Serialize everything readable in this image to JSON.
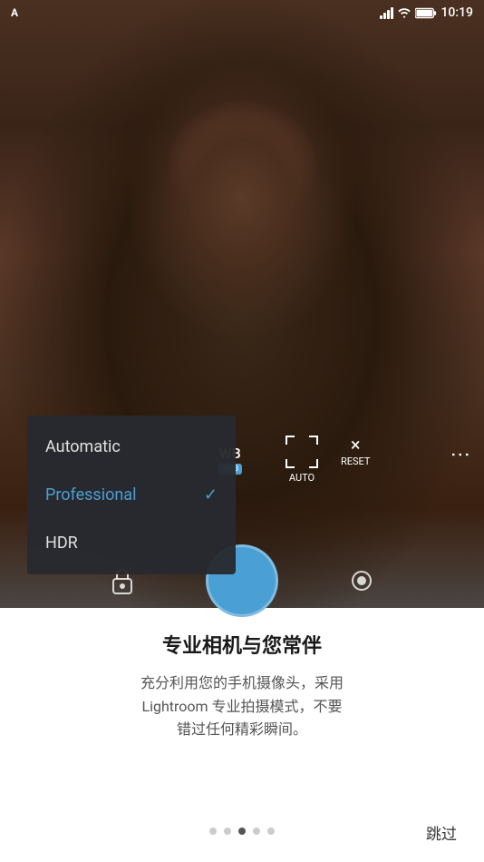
{
  "status_bar": {
    "time": "10:19"
  },
  "camera": {
    "wb_label": "WB",
    "wb_badge": "AWB",
    "auto_label": "AUTO",
    "reset_label": "RESET",
    "dots_label": "⋮"
  },
  "dropdown": {
    "items": [
      {
        "id": "automatic",
        "label": "Automatic",
        "selected": false
      },
      {
        "id": "professional",
        "label": "Professional",
        "selected": true
      },
      {
        "id": "hdr",
        "label": "HDR",
        "selected": false
      }
    ]
  },
  "bottom_panel": {
    "title": "专业相机与您常伴",
    "description": "充分利用您的手机摄像头，采用\nLightroom 专业拍摄模式，不要\n错过任何精彩瞬间。",
    "skip_label": "跳过"
  },
  "dots": [
    {
      "active": false
    },
    {
      "active": false
    },
    {
      "active": true
    },
    {
      "active": false
    },
    {
      "active": false
    }
  ]
}
